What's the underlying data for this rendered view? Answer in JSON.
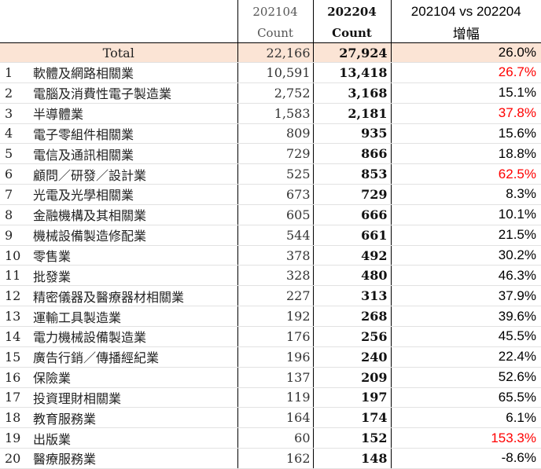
{
  "header": {
    "col_a_period": "202104",
    "col_a_sub": "Count",
    "col_b_period": "202204",
    "col_b_sub": "Count",
    "col_p_title": "202104 vs 202204",
    "col_p_sub": "增幅"
  },
  "total": {
    "label": "Total",
    "a": "22,166",
    "b": "27,924",
    "pct": "26.0%",
    "highlight": false
  },
  "rows": [
    {
      "rank": "1",
      "name": "軟體及網路相關業",
      "a": "10,591",
      "b": "13,418",
      "pct": "26.7%",
      "highlight": true
    },
    {
      "rank": "2",
      "name": "電腦及消費性電子製造業",
      "a": "2,752",
      "b": "3,168",
      "pct": "15.1%",
      "highlight": false
    },
    {
      "rank": "3",
      "name": "半導體業",
      "a": "1,583",
      "b": "2,181",
      "pct": "37.8%",
      "highlight": true
    },
    {
      "rank": "4",
      "name": "電子零組件相關業",
      "a": "809",
      "b": "935",
      "pct": "15.6%",
      "highlight": false
    },
    {
      "rank": "5",
      "name": "電信及通訊相關業",
      "a": "729",
      "b": "866",
      "pct": "18.8%",
      "highlight": false
    },
    {
      "rank": "6",
      "name": "顧問／研發／設計業",
      "a": "525",
      "b": "853",
      "pct": "62.5%",
      "highlight": true
    },
    {
      "rank": "7",
      "name": "光電及光學相關業",
      "a": "673",
      "b": "729",
      "pct": "8.3%",
      "highlight": false
    },
    {
      "rank": "8",
      "name": "金融機構及其相關業",
      "a": "605",
      "b": "666",
      "pct": "10.1%",
      "highlight": false
    },
    {
      "rank": "9",
      "name": "機械設備製造修配業",
      "a": "544",
      "b": "661",
      "pct": "21.5%",
      "highlight": false
    },
    {
      "rank": "10",
      "name": "零售業",
      "a": "378",
      "b": "492",
      "pct": "30.2%",
      "highlight": false
    },
    {
      "rank": "11",
      "name": "批發業",
      "a": "328",
      "b": "480",
      "pct": "46.3%",
      "highlight": false
    },
    {
      "rank": "12",
      "name": "精密儀器及醫療器材相關業",
      "a": "227",
      "b": "313",
      "pct": "37.9%",
      "highlight": false
    },
    {
      "rank": "13",
      "name": "運輸工具製造業",
      "a": "192",
      "b": "268",
      "pct": "39.6%",
      "highlight": false
    },
    {
      "rank": "14",
      "name": "電力機械設備製造業",
      "a": "176",
      "b": "256",
      "pct": "45.5%",
      "highlight": false
    },
    {
      "rank": "15",
      "name": "廣告行銷／傳播經紀業",
      "a": "196",
      "b": "240",
      "pct": "22.4%",
      "highlight": false
    },
    {
      "rank": "16",
      "name": "保險業",
      "a": "137",
      "b": "209",
      "pct": "52.6%",
      "highlight": false
    },
    {
      "rank": "17",
      "name": "投資理財相關業",
      "a": "119",
      "b": "197",
      "pct": "65.5%",
      "highlight": false
    },
    {
      "rank": "18",
      "name": "教育服務業",
      "a": "164",
      "b": "174",
      "pct": "6.1%",
      "highlight": false
    },
    {
      "rank": "19",
      "name": "出版業",
      "a": "60",
      "b": "152",
      "pct": "153.3%",
      "highlight": true
    },
    {
      "rank": "20",
      "name": "醫療服務業",
      "a": "162",
      "b": "148",
      "pct": "-8.6%",
      "highlight": false
    }
  ],
  "colors": {
    "highlight": "#ff0000",
    "total_bg": "#fbe4d5",
    "border": "#000000",
    "gridline": "#e2e2e2"
  }
}
